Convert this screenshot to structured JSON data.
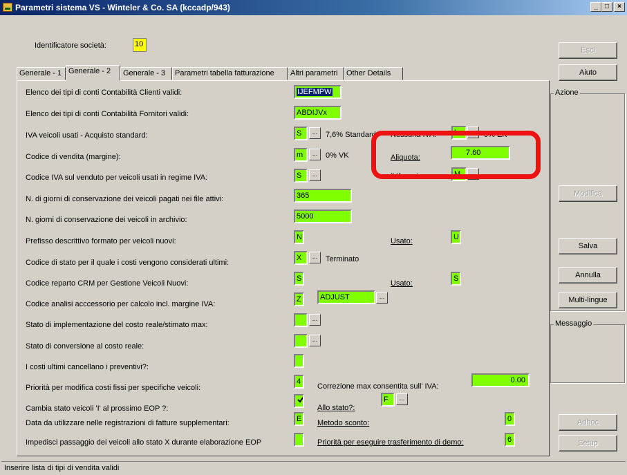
{
  "window": {
    "title": "Parametri sistema VS - Winteler & Co. SA (kccadp/943)"
  },
  "titlebar_buttons": {
    "minimize": "_",
    "maximize": "□",
    "close": "×"
  },
  "company": {
    "label": "Identificatore società:",
    "value": "10"
  },
  "tabs": [
    {
      "label": "Generale - 1"
    },
    {
      "label": "Generale - 2"
    },
    {
      "label": "Generale - 3"
    },
    {
      "label": "Parametri tabella fatturazione"
    },
    {
      "label": "Altri parametri"
    },
    {
      "label": "Other Details"
    }
  ],
  "fields": {
    "conti_clienti": {
      "label": "Elenco dei tipi di conti Contabilità Clienti validi:",
      "value": "IJEFMPW"
    },
    "conti_fornitori": {
      "label": "Elenco dei tipi di conti Contabilità Fornitori validi:",
      "value": "ABDIJVx"
    },
    "iva_veicoli": {
      "label": "IVA veicoli usati - Acquisto standard:",
      "value": "S",
      "desc": "7,6% Standard",
      "extra_label": "Nessuna IVA:",
      "extra_value": "L",
      "extra_desc": "0% EK"
    },
    "codice_vendita": {
      "label": "Codice di vendita (margine):",
      "value": "m",
      "desc": "0% VK",
      "aliquota_label": "Aliquota:",
      "aliquota_value": "7.60"
    },
    "codice_iva": {
      "label": "Codice IVA sul venduto per veicoli usati in regime IVA:",
      "value": "S",
      "extra_label": "IVA usato:",
      "extra_value": "M"
    },
    "giorni_attivi": {
      "label": "N. di giorni di conservazione dei veicoli pagati nei file attivi:",
      "value": "365"
    },
    "giorni_archivio": {
      "label": "N. giorni di conservazione dei veicoli in archivio:",
      "value": "5000"
    },
    "prefisso": {
      "label": "Prefisso descrittivo formato per veicoli nuovi:",
      "value": "N",
      "usato_label": "Usato:",
      "usato_value": "U"
    },
    "codice_stato": {
      "label": "Codice di stato per il quale i costi vengono considerati ultimi:",
      "value": "X",
      "desc": "Terminato"
    },
    "codice_reparto": {
      "label": "Codice reparto CRM per Gestione Veicoli Nuovi:",
      "value": "S",
      "usato_label": "Usato:",
      "usato_value": "S"
    },
    "codice_analisi": {
      "label": "Codice analisi acccessorio per calcolo incl. margine IVA:",
      "value": "Z",
      "value2": "ADJUST"
    },
    "stato_impl": {
      "label": "Stato di implementazione del costo reale/stimato max:",
      "value": ""
    },
    "stato_conv": {
      "label": "Stato di conversione al costo reale:",
      "value": ""
    },
    "costi_ultimi": {
      "label": "I costi ultimi cancellano i preventivi?:",
      "value": ""
    },
    "priorita": {
      "label": "Priorità per modifica costi fissi per specifiche veicoli:",
      "value": "4",
      "corr_label": "Correzione max consentita sull' IVA:",
      "corr_value": "0.00"
    },
    "cambia_stato": {
      "label": "Cambia stato veicoli 'I' al prossimo EOP ?:",
      "checked": true,
      "allo_label": "Allo stato?:",
      "allo_value": "F"
    },
    "data_reg": {
      "label": "Data da utilizzare nelle registrazioni di fatture supplementari:",
      "value": "E",
      "metodo_label": "Metodo sconto:",
      "metodo_value": "0"
    },
    "impedisci": {
      "label": "Impedisci passaggio dei veicoli allo stato X durante elaborazione EOP",
      "value": "",
      "prio_label": "Priorità per eseguire trasferimento di demo:",
      "prio_value": "6"
    }
  },
  "ellipsis": "...",
  "buttons": {
    "esci": "Esci",
    "aiuto": "Aiuto",
    "modifica": "Modifica",
    "salva": "Salva",
    "annulla": "Annulla",
    "multilingue": "Multi-lingue",
    "adhoc": "Adhoc",
    "setup": "Setup"
  },
  "groups": {
    "azione": "Azione",
    "messaggio": "Messaggio"
  },
  "status": {
    "text": "Inserire lista di tipi di vendita validi"
  },
  "colors": {
    "field_bg": "#80ff00",
    "highlight": "#ee1111",
    "window_bg": "#d4d0c8"
  }
}
